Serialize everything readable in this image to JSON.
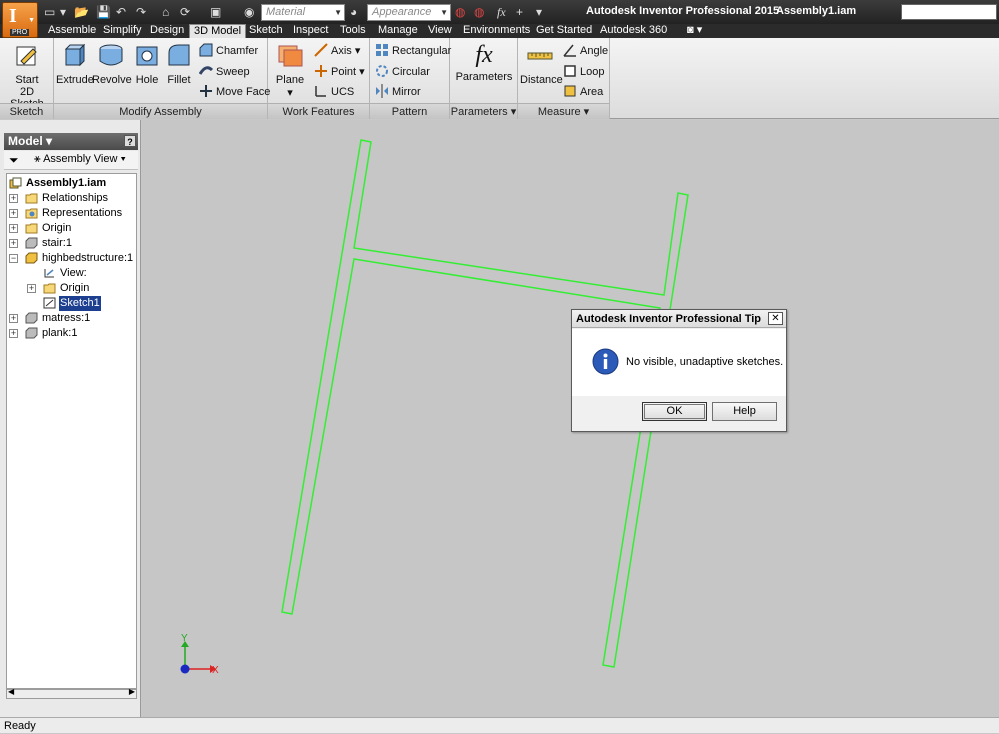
{
  "app": {
    "pro_badge": "PRO",
    "title": "Autodesk Inventor Professional 2015",
    "document": "Assembly1.iam",
    "material_placeholder": "Material",
    "appearance_placeholder": "Appearance",
    "fx_label": "fx"
  },
  "tabs": [
    "Assemble",
    "Simplify",
    "Design",
    "3D Model",
    "Sketch",
    "Inspect",
    "Tools",
    "Manage",
    "View",
    "Environments",
    "Get Started",
    "Autodesk 360"
  ],
  "active_tab": "3D Model",
  "ribbon": {
    "sketch": {
      "title": "Sketch",
      "start_line1": "Start",
      "start_line2": "2D Sketch"
    },
    "modify": {
      "title": "Modify Assembly",
      "extrude": "Extrude",
      "revolve": "Revolve",
      "hole": "Hole",
      "fillet": "Fillet",
      "chamfer": "Chamfer",
      "sweep": "Sweep",
      "move_face": "Move Face"
    },
    "work": {
      "title": "Work Features",
      "plane": "Plane",
      "axis": "Axis",
      "point": "Point",
      "ucs": "UCS"
    },
    "pattern": {
      "title": "Pattern",
      "rectangular": "Rectangular",
      "circular": "Circular",
      "mirror": "Mirror"
    },
    "parameters": {
      "title": "Parameters",
      "parameters": "Parameters",
      "fx": "fx"
    },
    "measure": {
      "title": "Measure",
      "distance": "Distance",
      "angle": "Angle",
      "loop": "Loop",
      "area": "Area"
    }
  },
  "browser": {
    "title": "Model",
    "help": "?",
    "view_mode": "Assembly View",
    "tree": {
      "root": "Assembly1.iam",
      "relationships": "Relationships",
      "representations": "Representations",
      "origin": "Origin",
      "stair": "stair:1",
      "highbed": "highbedstructure:1",
      "view": "View:",
      "origin2": "Origin",
      "sketch": "Sketch1",
      "matress": "matress:1",
      "plank": "plank:1"
    }
  },
  "viewport": {
    "axis_x": "X",
    "axis_y": "Y",
    "sketch_color": "#33ee33"
  },
  "dialog": {
    "title": "Autodesk Inventor Professional Tip",
    "close": "✕",
    "message": "No visible, unadaptive sketches.",
    "ok": "OK",
    "help": "Help"
  },
  "status": "Ready"
}
